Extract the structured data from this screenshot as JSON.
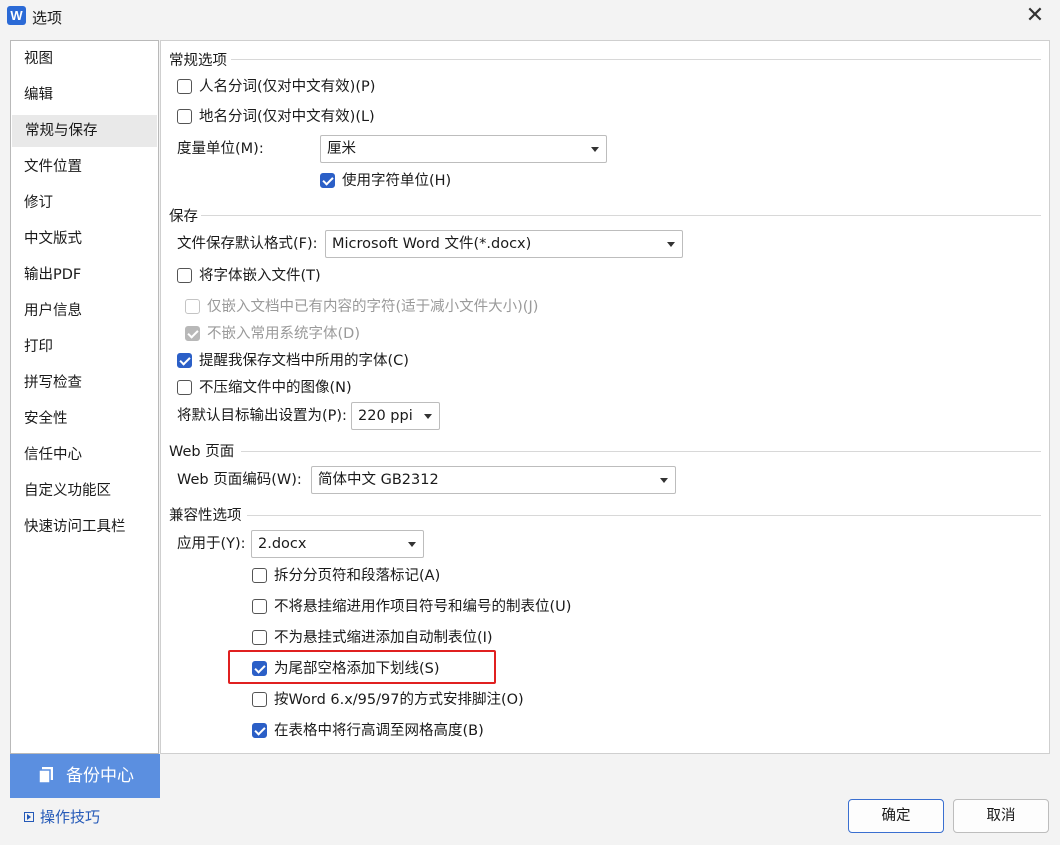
{
  "window": {
    "title": "选项",
    "logo": "W"
  },
  "sidebar": {
    "items": [
      "视图",
      "编辑",
      "常规与保存",
      "文件位置",
      "修订",
      "中文版式",
      "输出PDF",
      "用户信息",
      "打印",
      "拼写检查",
      "安全性",
      "信任中心",
      "自定义功能区",
      "快速访问工具栏"
    ],
    "active": "常规与保存",
    "backup_label": "备份中心",
    "tips_label": "操作技巧"
  },
  "general": {
    "heading": "常规选项",
    "name_seg": "人名分词(仅对中文有效)(P)",
    "place_seg": "地名分词(仅对中文有效)(L)",
    "unit_label": "度量单位(M):",
    "unit_value": "厘米",
    "use_char_unit": "使用字符单位(H)"
  },
  "save": {
    "heading": "保存",
    "format_label": "文件保存默认格式(F):",
    "format_value": "Microsoft Word 文件(*.docx)",
    "embed_fonts": "将字体嵌入文件(T)",
    "embed_used_only": "仅嵌入文档中已有内容的字符(适于减小文件大小)(J)",
    "no_embed_system": "不嵌入常用系统字体(D)",
    "remind_fonts": "提醒我保存文档中所用的字体(C)",
    "no_compress": "不压缩文件中的图像(N)",
    "ppi_label": "将默认目标输出设置为(P):",
    "ppi_value": "220 ppi"
  },
  "web": {
    "heading": "Web 页面",
    "encoding_label": "Web 页面编码(W):",
    "encoding_value": "简体中文 GB2312"
  },
  "compat": {
    "heading": "兼容性选项",
    "apply_label": "应用于(Y):",
    "apply_value": "2.docx",
    "opt1": "拆分分页符和段落标记(A)",
    "opt2": "不将悬挂缩进用作项目符号和编号的制表位(U)",
    "opt3": "不为悬挂式缩进添加自动制表位(I)",
    "opt4": "为尾部空格添加下划线(S)",
    "opt5": "按Word 6.x/95/97的方式安排脚注(O)",
    "opt6": "在表格中将行高调至网格高度(B)"
  },
  "buttons": {
    "ok": "确定",
    "cancel": "取消"
  },
  "colors": {
    "accent": "#2b5fc7",
    "backup_bg": "#5b8fe0",
    "highlight": "#e02020"
  }
}
